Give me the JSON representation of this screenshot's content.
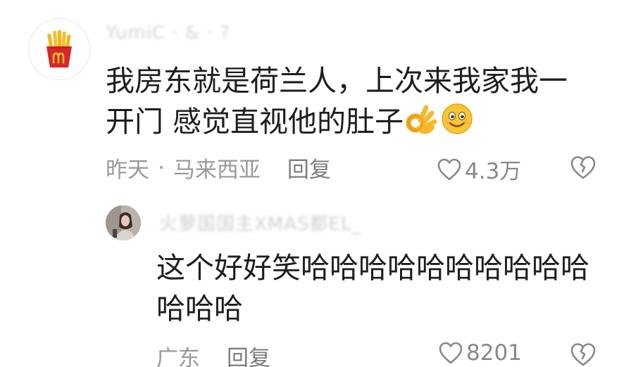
{
  "comment": {
    "avatar_icon": "fries-logo-icon",
    "username": "YumiC · & · ?",
    "text_line1": "我房东就是荷兰人，上次来我家我一",
    "text_line2": "开门 感觉直视他的肚子",
    "emoji_1": "ok-hand-emoji",
    "emoji_2": "smiley-emoji",
    "time": "昨天",
    "separator": "·",
    "location": "马来西亚",
    "reply_label": "回复",
    "like_count": "4.3万"
  },
  "reply": {
    "avatar_icon": "profile-photo",
    "username": "火萝国国主XMAS都EL_",
    "text_line1": "这个好好笑哈哈哈哈哈哈哈哈哈哈",
    "text_line2": "哈哈哈",
    "location": "广东",
    "reply_label": "回复",
    "like_count": "8201"
  },
  "colors": {
    "text_primary": "#1e1e1e",
    "text_meta": "#9a9a9a",
    "icon_gray": "#888888",
    "fries_red": "#d8262c",
    "fries_yellow": "#f4b81c"
  }
}
